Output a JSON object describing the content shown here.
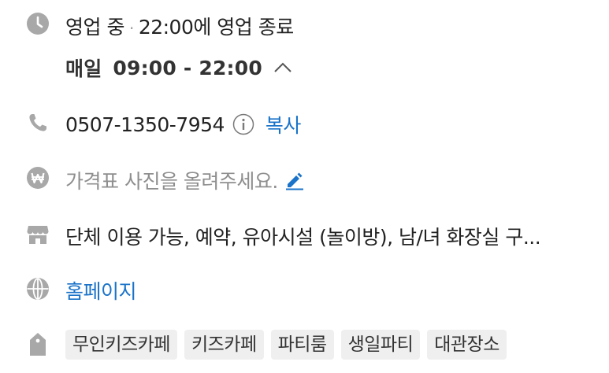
{
  "hours": {
    "status": "영업 중",
    "separator": "·",
    "closing": "22:00에 영업 종료",
    "schedule_day": "매일",
    "schedule_time": "09:00 - 22:00"
  },
  "phone": {
    "number": "0507-1350-7954",
    "copy_label": "복사"
  },
  "price": {
    "prompt": "가격표 사진을 올려주세요."
  },
  "facilities": {
    "text": "단체 이용 가능, 예약, 유아시설 (놀이방), 남/녀 화장실 구..."
  },
  "homepage": {
    "label": "홈페이지"
  },
  "tags": [
    "무인키즈카페",
    "키즈카페",
    "파티룸",
    "생일파티",
    "대관장소"
  ],
  "colors": {
    "icon_gray": "#a8a8a8",
    "link_blue": "#1a73c9",
    "tag_bg": "#efefef"
  }
}
